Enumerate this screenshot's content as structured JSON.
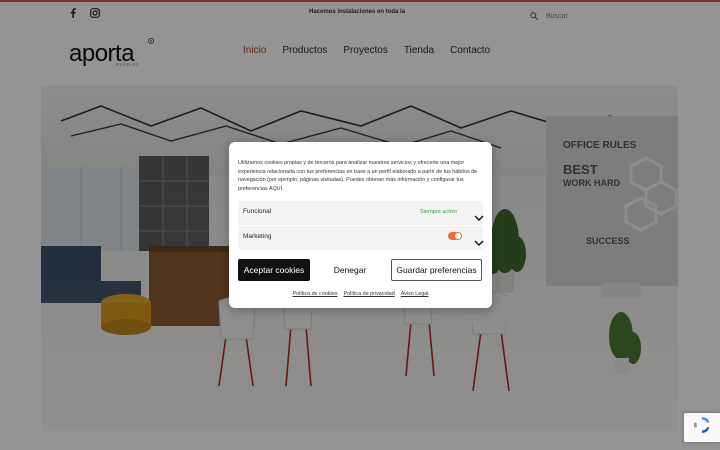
{
  "topbar": {
    "social": [
      {
        "icon": "facebook-icon",
        "glyph": "f"
      },
      {
        "icon": "instagram-icon",
        "glyph": ""
      }
    ],
    "promo": "Hacemos instalaciones en toda la",
    "search_placeholder": "Buscar",
    "accent_color": "#d9534f"
  },
  "header": {
    "logo_text": "aporta",
    "logo_subtext": "MUEBLES",
    "nav": [
      {
        "label": "Inicio",
        "active": true
      },
      {
        "label": "Productos",
        "active": false
      },
      {
        "label": "Proyectos",
        "active": false
      },
      {
        "label": "Tienda",
        "active": false
      },
      {
        "label": "Contacto",
        "active": false
      }
    ],
    "active_color": "#c0392b"
  },
  "hero": {
    "wall_text": [
      "OFFICE RULES",
      "WORK HARD",
      "BEST",
      "SUCCESS"
    ]
  },
  "cookie_modal": {
    "intro": "Utilizamos cookies propias y de terceros para analizar nuestros servicios y ofrecerte una mejor experiencia relacionada con tus preferencias en base a un perfil elaborado a partir de tus hábitos de navegación (por ejemplo, páginas visitadas). Puedes obtener más información y configurar tus preferencias AQUÍ.",
    "preferences": [
      {
        "label": "Funcional",
        "status": "Siempre activo"
      },
      {
        "label": "Marketing",
        "toggle_on": false
      }
    ],
    "buttons": {
      "accept": "Aceptar cookies",
      "deny": "Denegar",
      "save": "Guardar preferencias"
    },
    "links": [
      "Política de cookies",
      "Política de privacidad",
      "Aviso Legal"
    ]
  },
  "recaptcha": {
    "icon": "recaptcha-icon"
  }
}
